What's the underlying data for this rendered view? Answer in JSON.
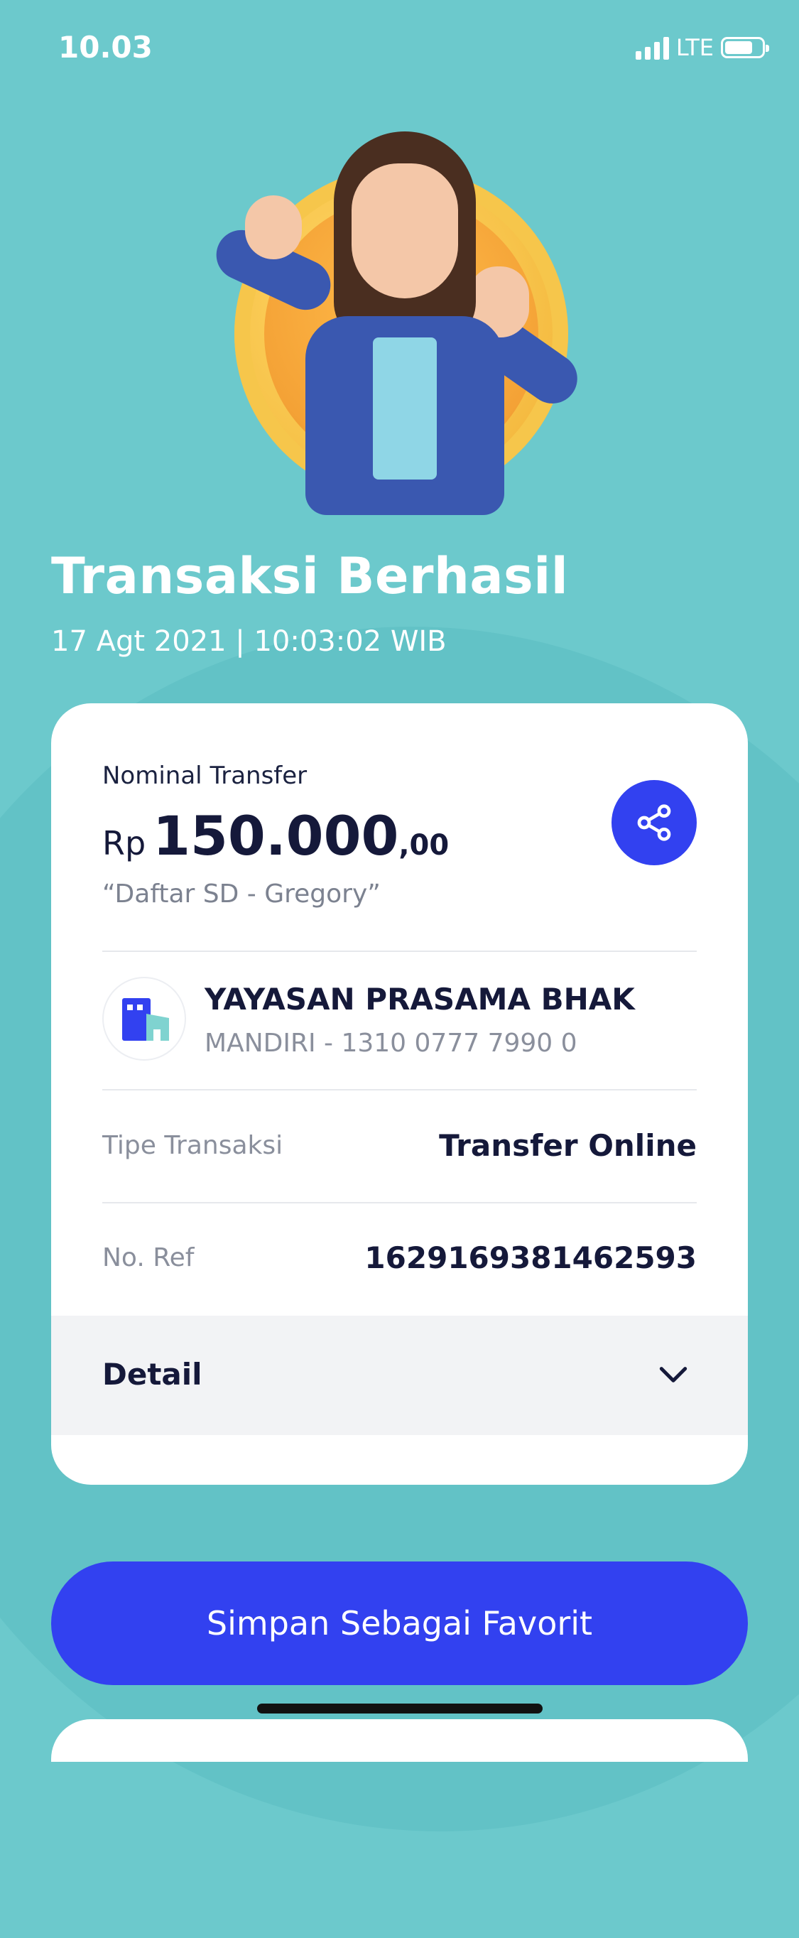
{
  "status_bar": {
    "time": "10.03",
    "network": "LTE"
  },
  "header": {
    "title": "Transaksi Berhasil",
    "timestamp": "17 Agt 2021  |  10:03:02 WIB"
  },
  "transfer": {
    "amount_label": "Nominal Transfer",
    "currency": "Rp",
    "amount_main": "150.000",
    "amount_decimal": ",00",
    "note": "“Daftar SD - Gregory”"
  },
  "recipient": {
    "name": "YAYASAN PRASAMA BHAK",
    "account": "MANDIRI - 1310 0777 7990 0"
  },
  "rows": [
    {
      "label": "Tipe Transaksi",
      "value": "Transfer Online"
    },
    {
      "label": "No. Ref",
      "value": "1629169381462593"
    }
  ],
  "detail": {
    "label": "Detail"
  },
  "actions": {
    "favorite_label": "Simpan Sebagai Favorit"
  },
  "colors": {
    "background": "#6cc9cc",
    "primary": "#3241f0",
    "text_dark": "#15193a"
  },
  "icons": [
    "share-icon",
    "building-icon",
    "chevron-down-icon",
    "signal-icon",
    "battery-icon"
  ]
}
